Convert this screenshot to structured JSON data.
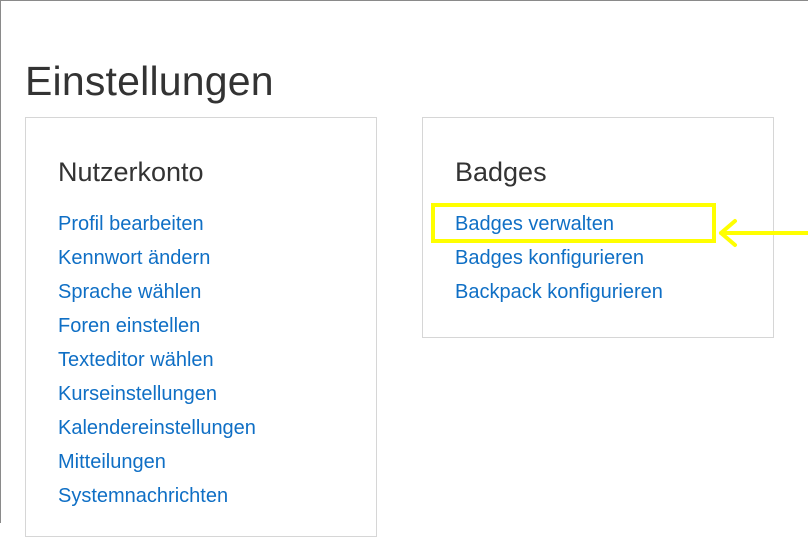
{
  "page": {
    "title": "Einstellungen"
  },
  "account_card": {
    "title": "Nutzerkonto",
    "links": [
      "Profil bearbeiten",
      "Kennwort ändern",
      "Sprache wählen",
      "Foren einstellen",
      "Texteditor wählen",
      "Kurseinstellungen",
      "Kalendereinstellungen",
      "Mitteilungen",
      "Systemnachrichten"
    ]
  },
  "badges_card": {
    "title": "Badges",
    "links": [
      "Badges verwalten",
      "Badges konfigurieren",
      "Backpack konfigurieren"
    ]
  },
  "annotation": {
    "highlight_color": "#ffff00",
    "highlighted_link": "Badges verwalten"
  },
  "colors": {
    "link": "#0f6fc5",
    "heading": "#333333",
    "card_border": "#d6d6d6"
  }
}
